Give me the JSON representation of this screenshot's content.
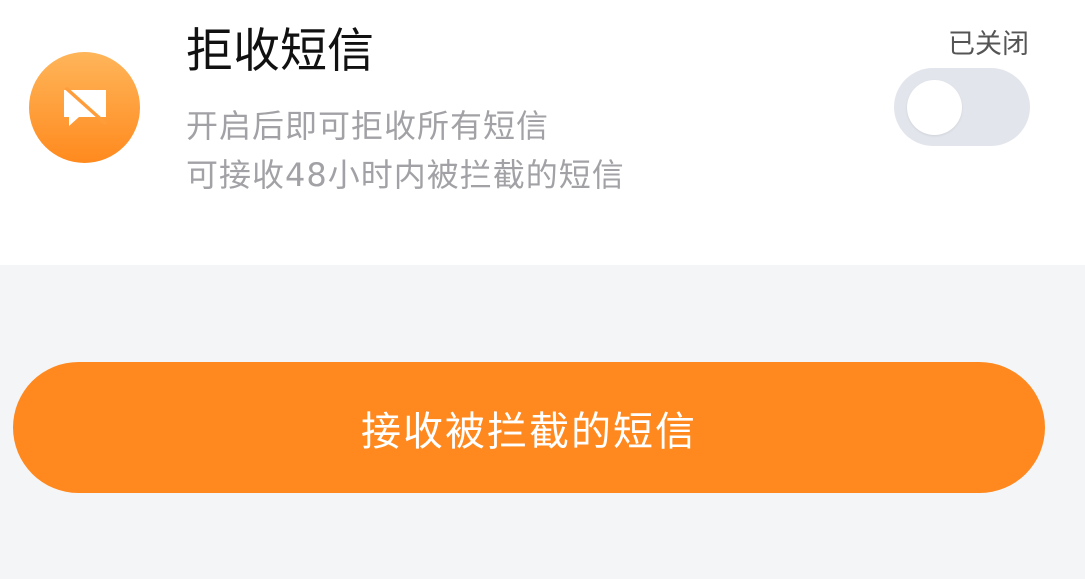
{
  "setting": {
    "title": "拒收短信",
    "description_lines": [
      "开启后即可拒收所有短信",
      "可接收48小时内被拦截的短信"
    ],
    "status_label": "已关闭",
    "toggle_state": "off",
    "icon": "message-blocked-icon"
  },
  "action_button": {
    "label": "接收被拦截的短信"
  },
  "colors": {
    "accent": "#ff891e",
    "icon_gradient_top": "#ffb55a",
    "toggle_off_track": "#e2e5ec",
    "background": "#f4f5f7"
  }
}
